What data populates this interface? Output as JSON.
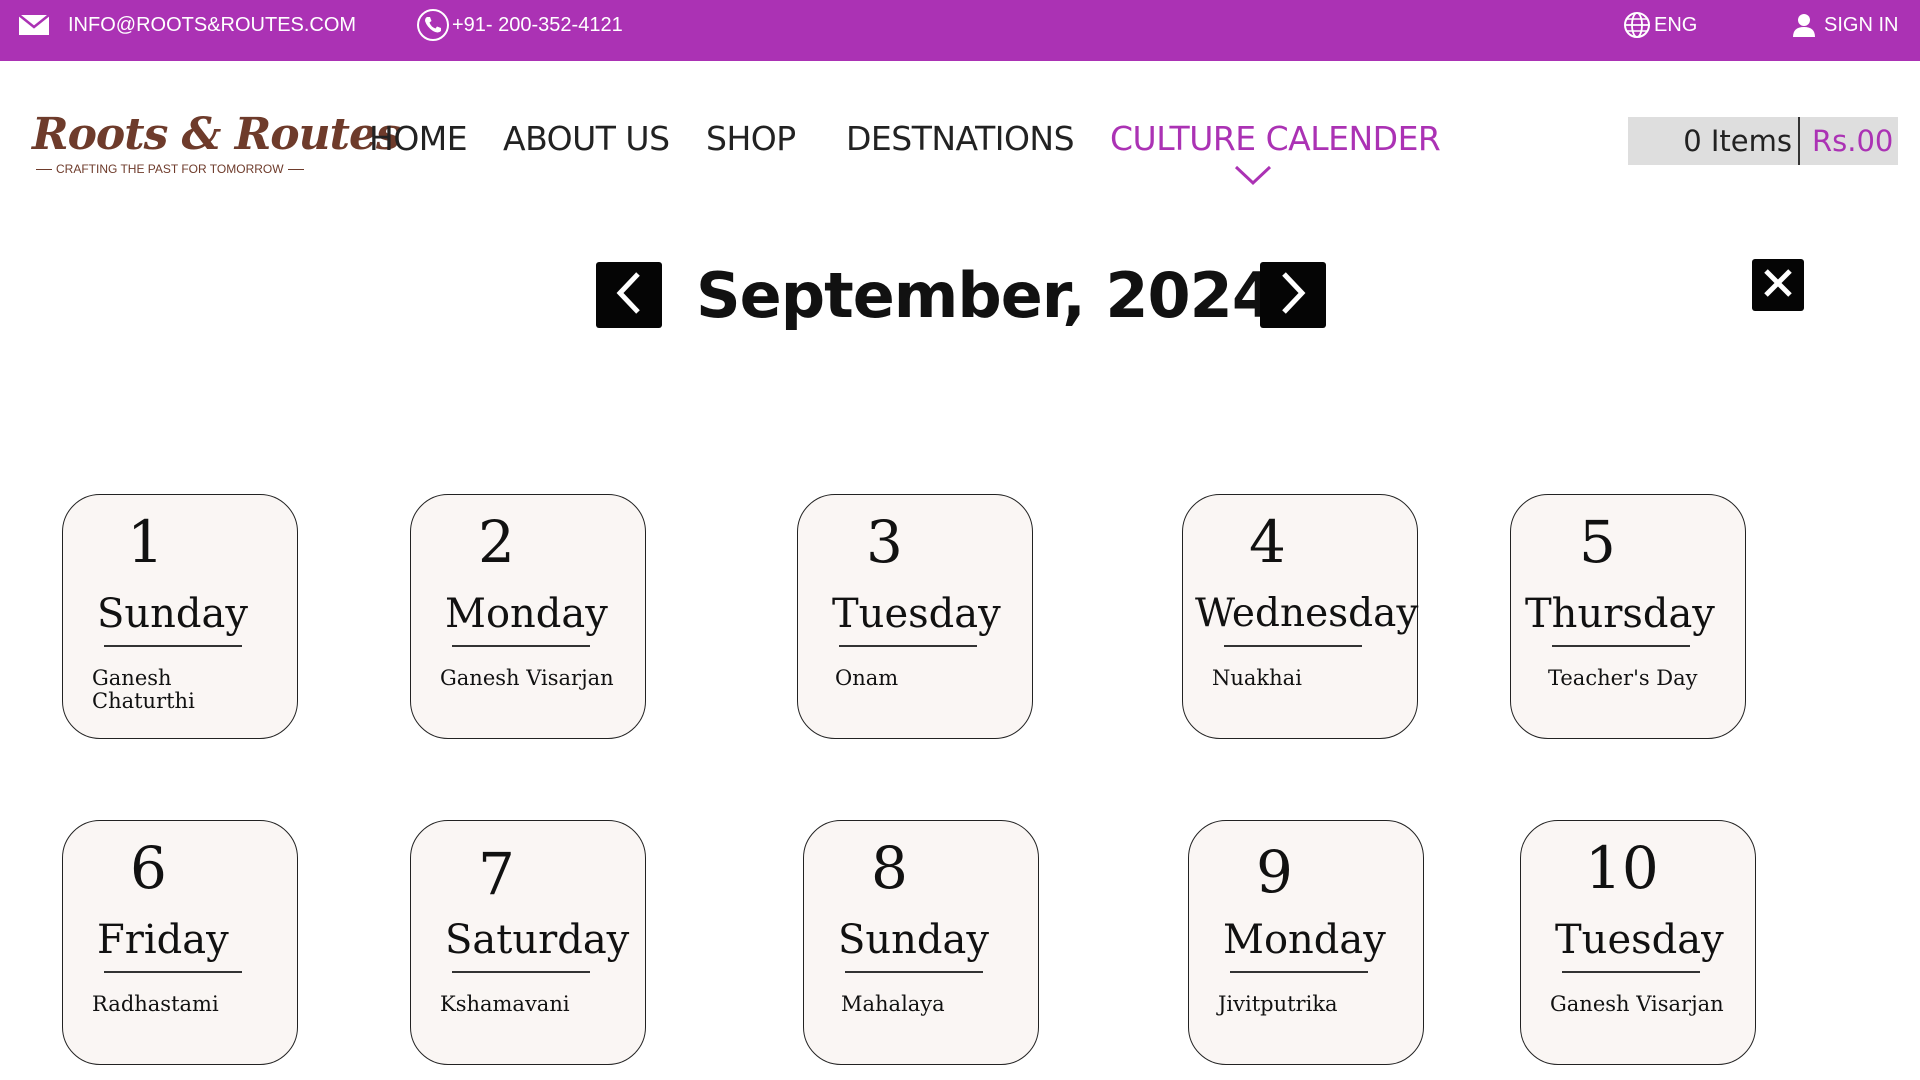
{
  "topbar": {
    "email": "INFO@ROOTS&ROUTES.COM",
    "phone": "+91- 200-352-4121",
    "language": "ENG",
    "sign_in": "SIGN IN"
  },
  "logo": {
    "title": "Roots & Routes",
    "tagline": "CRAFTING THE PAST FOR TOMORROW"
  },
  "nav": {
    "home": "HOME",
    "about": "ABOUT US",
    "shop": "SHOP",
    "destinations": "DESTNATIONS",
    "culture": "CULTURE CALENDER"
  },
  "cart": {
    "items": "0 Items",
    "total": "Rs.00"
  },
  "calendar": {
    "month_title": "September, 2024",
    "days": [
      {
        "num": "1",
        "weekday": "Sunday",
        "event": "Ganesh Chaturthi"
      },
      {
        "num": "2",
        "weekday": "Monday",
        "event": "Ganesh Visarjan"
      },
      {
        "num": "3",
        "weekday": "Tuesday",
        "event": "Onam"
      },
      {
        "num": "4",
        "weekday": "Wednesday",
        "event": "Nuakhai"
      },
      {
        "num": "5",
        "weekday": "Thursday",
        "event": "Teacher's Day"
      },
      {
        "num": "6",
        "weekday": "Friday",
        "event": "Radhastami"
      },
      {
        "num": "7",
        "weekday": "Saturday",
        "event": "Kshamavani"
      },
      {
        "num": "8",
        "weekday": "Sunday",
        "event": "Mahalaya"
      },
      {
        "num": "9",
        "weekday": "Monday",
        "event": "Jivitputrika"
      },
      {
        "num": "10",
        "weekday": "Tuesday",
        "event": "Ganesh Visarjan"
      }
    ]
  },
  "colors": {
    "accent": "#ab32b4",
    "brand": "#6e3b2b",
    "card_bg": "#faf6f4"
  },
  "icons": {
    "email": "mail-icon",
    "phone": "phone-icon",
    "language": "globe-icon",
    "user": "user-icon",
    "prev": "chevron-left-icon",
    "next": "chevron-right-icon",
    "close": "close-icon",
    "nav_active": "chevron-down-icon"
  }
}
